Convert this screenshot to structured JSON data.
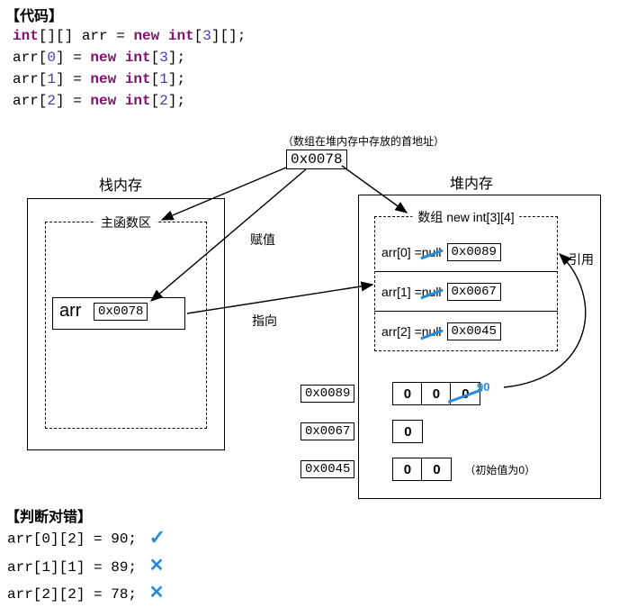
{
  "titles": {
    "code": "【代码】",
    "judge": "【判断对错】"
  },
  "code": {
    "l1_type": "int",
    "l1_brackets1": "[][] ",
    "l1_ident": "arr",
    "l1_eq": " = ",
    "l1_new": "new ",
    "l1_type2": "int",
    "l1_num": "3",
    "l1_end": "[][];",
    "l2_ident": "arr[",
    "l2_idx": "0",
    "l2_mid": "] = ",
    "l2_new": "new ",
    "l2_type": "int",
    "l2_num": "3",
    "l2_end": "[];",
    "l3_ident": "arr[",
    "l3_idx": "1",
    "l3_mid": "] = ",
    "l3_new": "new ",
    "l3_type": "int",
    "l3_num": "1",
    "l3_end": "[];",
    "l4_ident": "arr[",
    "l4_idx": "2",
    "l4_mid": "] = ",
    "l4_new": "new ",
    "l4_type": "int",
    "l4_num": "2",
    "l4_end": "[];"
  },
  "diagram": {
    "top_note": "（数组在堆内存中存放的首地址）",
    "top_addr": "0x0078",
    "stack_title": "栈内存",
    "heap_title": "堆内存",
    "main_area": "主函数区",
    "arr_label": "arr",
    "arr_addr": "0x0078",
    "array_box_title": "数组 new int[3][4]",
    "assign_label": "赋值",
    "point_label": "指向",
    "ref_label": "引用",
    "rows": [
      {
        "label": "arr[0] = ",
        "null": "null",
        "addr": "0x0089"
      },
      {
        "label": "arr[1] = ",
        "null": "null",
        "addr": "0x0067"
      },
      {
        "label": "arr[2] = ",
        "null": "null",
        "addr": "0x0045"
      }
    ],
    "mem_rows": [
      {
        "addr": "0x0089",
        "cells": [
          "0",
          "0",
          "0"
        ],
        "overlay": "90"
      },
      {
        "addr": "0x0067",
        "cells": [
          "0"
        ]
      },
      {
        "addr": "0x0045",
        "cells": [
          "0",
          "0"
        ]
      }
    ],
    "init_note": "（初始值为0）"
  },
  "judge": {
    "lines": [
      {
        "text": "arr[0][2] = 90;",
        "mark": "✓"
      },
      {
        "text": "arr[1][1] = 89;",
        "mark": "✕"
      },
      {
        "text": "arr[2][2] = 78;",
        "mark": "✕"
      }
    ]
  }
}
